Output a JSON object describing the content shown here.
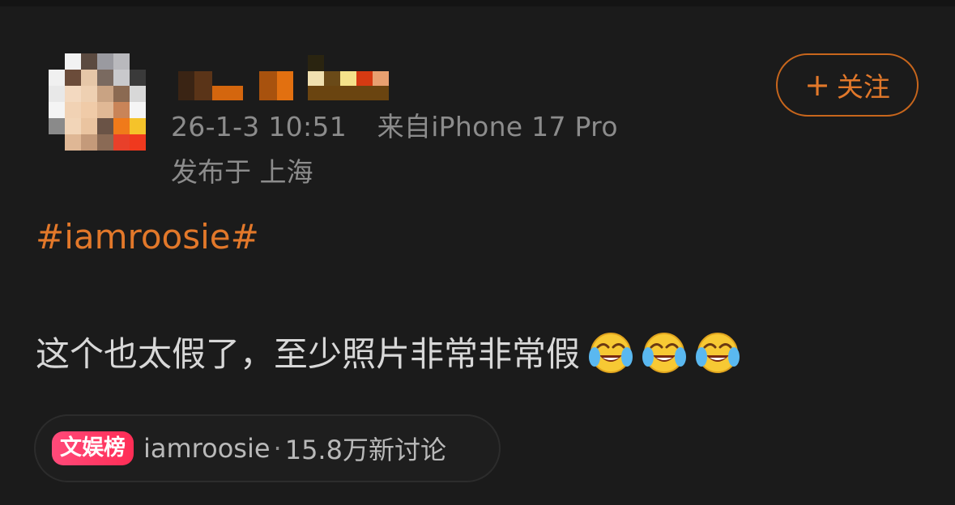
{
  "post": {
    "timestamp": "26-1-3 10:51",
    "source": "来自iPhone 17 Pro",
    "location": "发布于 上海",
    "hashtag": "#iamroosie#",
    "text": "这个也太假了，至少照片非常非常假"
  },
  "follow_button": {
    "plus": "+",
    "label": "关注"
  },
  "topic": {
    "badge": "文娱榜",
    "name": "iamroosie",
    "separator": "·",
    "count": "15.8万新讨论"
  },
  "icons": {
    "avatar": "avatar-mosaic",
    "emoji": "laughing-crying-emoji",
    "plus": "plus-icon"
  },
  "colors": {
    "accent": "#e2782a",
    "background": "#1b1b1b",
    "badge": "#ff2d55"
  }
}
